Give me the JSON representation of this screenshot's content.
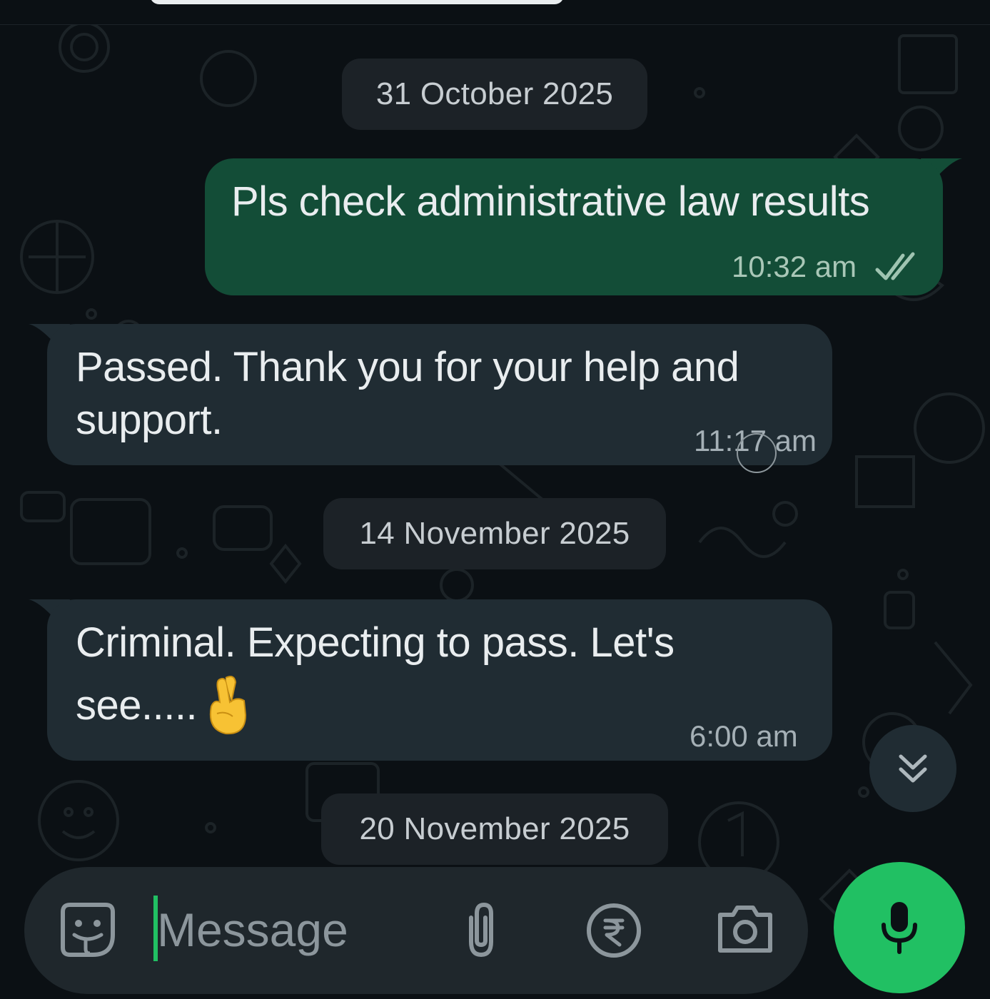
{
  "dates": [
    "31 October 2025",
    "14 November 2025",
    "20 November 2025"
  ],
  "messages": [
    {
      "direction": "outgoing",
      "text": "Pls check administrative law results",
      "time": "10:32 am",
      "status": "read-double-check-icon"
    },
    {
      "direction": "incoming",
      "line1": "Passed.  Thank you for your help and",
      "line2": "support.",
      "time": "11:17 am"
    },
    {
      "direction": "incoming",
      "line1": "Criminal.  Expecting to pass. Let's",
      "line2": "see.....",
      "emoji": "crossed-fingers",
      "time": "6:00 am"
    }
  ],
  "composer": {
    "placeholder": "Message",
    "icons": [
      "sticker-icon",
      "attach-icon",
      "rupee-payment-icon",
      "camera-icon",
      "mic-icon"
    ]
  },
  "colors": {
    "background": "#0b1014",
    "outgoing_bubble": "#134d37",
    "incoming_bubble": "#202c33",
    "accent": "#21c063"
  }
}
